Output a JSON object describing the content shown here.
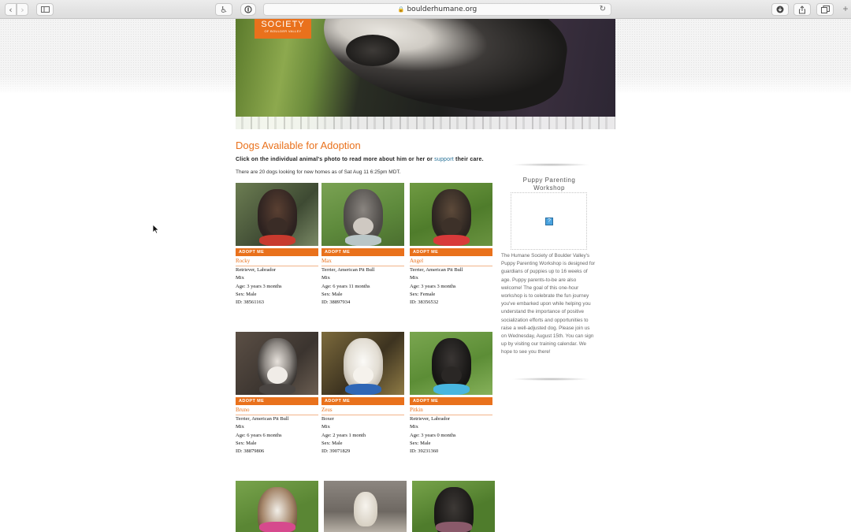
{
  "browser": {
    "url": "boulderhumane.org",
    "back_icon": "chevron-left-icon",
    "forward_icon": "chevron-right-icon",
    "sidebar_icon": "sidebar-icon",
    "reload_icon": "reload-icon"
  },
  "logo": {
    "line1": "SOCIETY",
    "line2": "OF BOULDER VALLEY"
  },
  "content": {
    "title": "Dogs Available for Adoption",
    "intro_before": "Click on the individual animal's photo to read more about him or her or ",
    "intro_link": "support",
    "intro_after": " their care.",
    "count_line": "There are 20 dogs looking for new homes as of Sat Aug 11 6:25pm MDT."
  },
  "dogs": [
    {
      "adopt": "ADOPT ME",
      "name": "Rocky",
      "breed": "Retriever, Labrador",
      "mix": "Mix",
      "age": "Age: 3 years 3 months",
      "sex": "Sex: Male",
      "id": "ID: 38561163"
    },
    {
      "adopt": "ADOPT ME",
      "name": "Max",
      "breed": "Terrier, American Pit Bull",
      "mix": "Mix",
      "age": "Age: 6 years 11 months",
      "sex": "Sex: Male",
      "id": "ID: 38897934"
    },
    {
      "adopt": "ADOPT ME",
      "name": "Angel",
      "breed": "Terrier, American Pit Bull",
      "mix": "Mix",
      "age": "Age: 3 years 3 months",
      "sex": "Sex: Female",
      "id": "ID: 38356532"
    },
    {
      "adopt": "ADOPT ME",
      "name": "Bruno",
      "breed": "Terrier, American Pit Bull",
      "mix": "Mix",
      "age": "Age: 6 years 6 months",
      "sex": "Sex: Male",
      "id": "ID: 38879806"
    },
    {
      "adopt": "ADOPT ME",
      "name": "Zeus",
      "breed": "Boxer",
      "mix": "Mix",
      "age": "Age: 2 years 1 month",
      "sex": "Sex: Male",
      "id": "ID: 39071829"
    },
    {
      "adopt": "ADOPT ME",
      "name": "Pitkin",
      "breed": "Retriever, Labrador",
      "mix": "Mix",
      "age": "Age: 3 years 0 months",
      "sex": "Sex: Male",
      "id": "ID: 39231360"
    }
  ],
  "sidebar": {
    "title": "Puppy Parenting Workshop",
    "text": "The Humane Society of Boulder Valley's Puppy Parenting Workshop is designed for guardians of puppies up to 16 weeks of age. Puppy parents-to-be are also welcome! The goal of this one-hour workshop is to celebrate the fun journey you've embarked upon while helping you understand the importance of positive socialization efforts and opportunities to raise a well-adjusted dog. Please join us on Wednesday, August 15th. You can sign up by visiting our training calendar. We hope to see you there!",
    "broken_image_glyph": "?"
  },
  "colors": {
    "accent": "#e9711c",
    "link": "#1f6d95"
  }
}
